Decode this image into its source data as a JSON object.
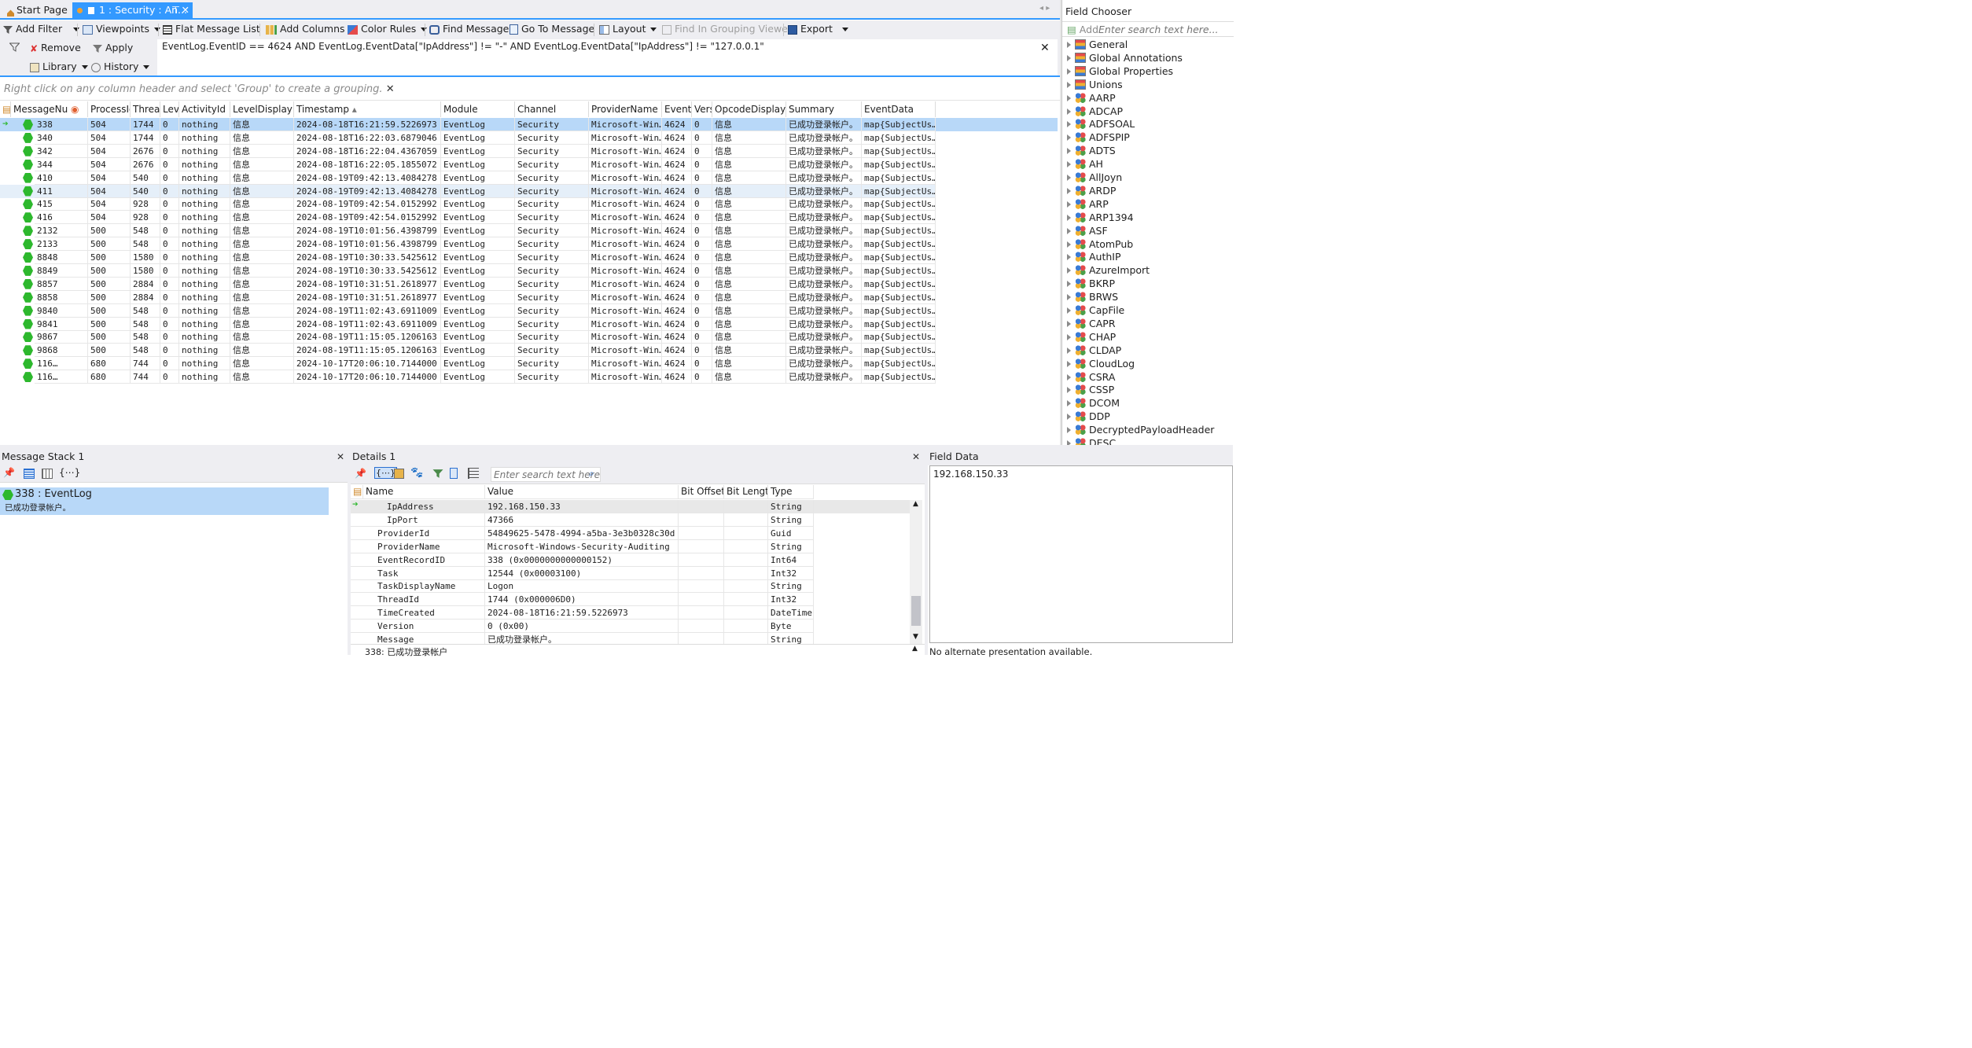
{
  "tabs": {
    "start_label": "Start Page",
    "active_label": "1 : Security : An..."
  },
  "toolbar": {
    "add_filter": "Add Filter",
    "viewpoints": "Viewpoints",
    "flat_list": "Flat Message List",
    "add_columns": "Add Columns",
    "color_rules": "Color Rules",
    "find_message": "Find Message",
    "go_to_message": "Go To Message",
    "layout": "Layout",
    "find_grouping": "Find In Grouping Viewer",
    "export": "Export"
  },
  "filter": {
    "remove": "Remove",
    "apply": "Apply",
    "library": "Library",
    "history": "History",
    "expression": "EventLog.EventID == 4624 AND EventLog.EventData[\"IpAddress\"] != \"-\" AND EventLog.EventData[\"IpAddress\"] != \"127.0.0.1\""
  },
  "grouping_hint": "Right click on any column header and select 'Group' to create a grouping.",
  "grid": {
    "columns": [
      "MessageNu",
      "ProcessId",
      "Threac",
      "Leve",
      "ActivityId",
      "LevelDisplayNa",
      "Timestamp",
      "Module",
      "Channel",
      "ProviderName",
      "EventI",
      "Vers",
      "OpcodeDisplayNa",
      "Summary",
      "EventData"
    ],
    "rows": [
      [
        "338",
        "504",
        "1744",
        "0",
        "nothing",
        "信息",
        "2024-08-18T16:21:59.5226973",
        "EventLog",
        "Security",
        "Microsoft-Win…",
        "4624",
        "0",
        "信息",
        "已成功登录帐户。",
        "map{SubjectUs…"
      ],
      [
        "340",
        "504",
        "1744",
        "0",
        "nothing",
        "信息",
        "2024-08-18T16:22:03.6879046",
        "EventLog",
        "Security",
        "Microsoft-Win…",
        "4624",
        "0",
        "信息",
        "已成功登录帐户。",
        "map{SubjectUs…"
      ],
      [
        "342",
        "504",
        "2676",
        "0",
        "nothing",
        "信息",
        "2024-08-18T16:22:04.4367059",
        "EventLog",
        "Security",
        "Microsoft-Win…",
        "4624",
        "0",
        "信息",
        "已成功登录帐户。",
        "map{SubjectUs…"
      ],
      [
        "344",
        "504",
        "2676",
        "0",
        "nothing",
        "信息",
        "2024-08-18T16:22:05.1855072",
        "EventLog",
        "Security",
        "Microsoft-Win…",
        "4624",
        "0",
        "信息",
        "已成功登录帐户。",
        "map{SubjectUs…"
      ],
      [
        "410",
        "504",
        "540",
        "0",
        "nothing",
        "信息",
        "2024-08-19T09:42:13.4084278",
        "EventLog",
        "Security",
        "Microsoft-Win…",
        "4624",
        "0",
        "信息",
        "已成功登录帐户。",
        "map{SubjectUs…"
      ],
      [
        "411",
        "504",
        "540",
        "0",
        "nothing",
        "信息",
        "2024-08-19T09:42:13.4084278",
        "EventLog",
        "Security",
        "Microsoft-Win…",
        "4624",
        "0",
        "信息",
        "已成功登录帐户。",
        "map{SubjectUs…"
      ],
      [
        "415",
        "504",
        "928",
        "0",
        "nothing",
        "信息",
        "2024-08-19T09:42:54.0152992",
        "EventLog",
        "Security",
        "Microsoft-Win…",
        "4624",
        "0",
        "信息",
        "已成功登录帐户。",
        "map{SubjectUs…"
      ],
      [
        "416",
        "504",
        "928",
        "0",
        "nothing",
        "信息",
        "2024-08-19T09:42:54.0152992",
        "EventLog",
        "Security",
        "Microsoft-Win…",
        "4624",
        "0",
        "信息",
        "已成功登录帐户。",
        "map{SubjectUs…"
      ],
      [
        "2132",
        "500",
        "548",
        "0",
        "nothing",
        "信息",
        "2024-08-19T10:01:56.4398799",
        "EventLog",
        "Security",
        "Microsoft-Win…",
        "4624",
        "0",
        "信息",
        "已成功登录帐户。",
        "map{SubjectUs…"
      ],
      [
        "2133",
        "500",
        "548",
        "0",
        "nothing",
        "信息",
        "2024-08-19T10:01:56.4398799",
        "EventLog",
        "Security",
        "Microsoft-Win…",
        "4624",
        "0",
        "信息",
        "已成功登录帐户。",
        "map{SubjectUs…"
      ],
      [
        "8848",
        "500",
        "1580",
        "0",
        "nothing",
        "信息",
        "2024-08-19T10:30:33.5425612",
        "EventLog",
        "Security",
        "Microsoft-Win…",
        "4624",
        "0",
        "信息",
        "已成功登录帐户。",
        "map{SubjectUs…"
      ],
      [
        "8849",
        "500",
        "1580",
        "0",
        "nothing",
        "信息",
        "2024-08-19T10:30:33.5425612",
        "EventLog",
        "Security",
        "Microsoft-Win…",
        "4624",
        "0",
        "信息",
        "已成功登录帐户。",
        "map{SubjectUs…"
      ],
      [
        "8857",
        "500",
        "2884",
        "0",
        "nothing",
        "信息",
        "2024-08-19T10:31:51.2618977",
        "EventLog",
        "Security",
        "Microsoft-Win…",
        "4624",
        "0",
        "信息",
        "已成功登录帐户。",
        "map{SubjectUs…"
      ],
      [
        "8858",
        "500",
        "2884",
        "0",
        "nothing",
        "信息",
        "2024-08-19T10:31:51.2618977",
        "EventLog",
        "Security",
        "Microsoft-Win…",
        "4624",
        "0",
        "信息",
        "已成功登录帐户。",
        "map{SubjectUs…"
      ],
      [
        "9840",
        "500",
        "548",
        "0",
        "nothing",
        "信息",
        "2024-08-19T11:02:43.6911009",
        "EventLog",
        "Security",
        "Microsoft-Win…",
        "4624",
        "0",
        "信息",
        "已成功登录帐户。",
        "map{SubjectUs…"
      ],
      [
        "9841",
        "500",
        "548",
        "0",
        "nothing",
        "信息",
        "2024-08-19T11:02:43.6911009",
        "EventLog",
        "Security",
        "Microsoft-Win…",
        "4624",
        "0",
        "信息",
        "已成功登录帐户。",
        "map{SubjectUs…"
      ],
      [
        "9867",
        "500",
        "548",
        "0",
        "nothing",
        "信息",
        "2024-08-19T11:15:05.1206163",
        "EventLog",
        "Security",
        "Microsoft-Win…",
        "4624",
        "0",
        "信息",
        "已成功登录帐户。",
        "map{SubjectUs…"
      ],
      [
        "9868",
        "500",
        "548",
        "0",
        "nothing",
        "信息",
        "2024-08-19T11:15:05.1206163",
        "EventLog",
        "Security",
        "Microsoft-Win…",
        "4624",
        "0",
        "信息",
        "已成功登录帐户。",
        "map{SubjectUs…"
      ],
      [
        "116…",
        "680",
        "744",
        "0",
        "nothing",
        "信息",
        "2024-10-17T20:06:10.7144000",
        "EventLog",
        "Security",
        "Microsoft-Win…",
        "4624",
        "0",
        "信息",
        "已成功登录帐户。",
        "map{SubjectUs…"
      ],
      [
        "116…",
        "680",
        "744",
        "0",
        "nothing",
        "信息",
        "2024-10-17T20:06:10.7144000",
        "EventLog",
        "Security",
        "Microsoft-Win…",
        "4624",
        "0",
        "信息",
        "已成功登录帐户。",
        "map{SubjectUs…"
      ]
    ]
  },
  "field_chooser": {
    "title": "Field Chooser",
    "add_label": "Add",
    "search_placeholder": "Enter search text here...",
    "items": [
      "General",
      "Global Annotations",
      "Global Properties",
      "Unions",
      "AARP",
      "ADCAP",
      "ADFSOAL",
      "ADFSPIP",
      "ADTS",
      "AH",
      "AllJoyn",
      "ARDP",
      "ARP",
      "ARP1394",
      "ASF",
      "AtomPub",
      "AuthIP",
      "AzureImport",
      "BKRP",
      "BRWS",
      "CapFile",
      "CAPR",
      "CHAP",
      "CLDAP",
      "CloudLog",
      "CSRA",
      "CSSP",
      "DCOM",
      "DDP",
      "DecryptedPayloadHeader",
      "DESC"
    ]
  },
  "message_stack": {
    "title": "Message Stack 1",
    "entry_title": "338 : EventLog",
    "entry_sub": "已成功登录帐户。"
  },
  "details": {
    "title": "Details 1",
    "search_placeholder": "Enter search text here",
    "columns": [
      "Name",
      "Value",
      "Bit Offset",
      "Bit Length",
      "Type"
    ],
    "rows": [
      [
        "IpAddress",
        "192.168.150.33",
        "",
        "",
        "String"
      ],
      [
        "IpPort",
        "47366",
        "",
        "",
        "String"
      ],
      [
        "ProviderId",
        "54849625-5478-4994-a5ba-3e3b0328c30d",
        "",
        "",
        "Guid"
      ],
      [
        "ProviderName",
        "Microsoft-Windows-Security-Auditing",
        "",
        "",
        "String"
      ],
      [
        "EventRecordID",
        "338 (0x0000000000000152)",
        "",
        "",
        "Int64"
      ],
      [
        "Task",
        "12544 (0x00003100)",
        "",
        "",
        "Int32"
      ],
      [
        "TaskDisplayName",
        "Logon",
        "",
        "",
        "String"
      ],
      [
        "ThreadId",
        "1744 (0x000006D0)",
        "",
        "",
        "Int32"
      ],
      [
        "TimeCreated",
        "2024-08-18T16:21:59.5226973",
        "",
        "",
        "DateTime"
      ],
      [
        "Version",
        "0 (0x00)",
        "",
        "",
        "Byte"
      ],
      [
        "Message",
        "已成功登录帐户。",
        "",
        "",
        "String"
      ]
    ],
    "footer": "338: 已成功登录帐户"
  },
  "field_data": {
    "title": "Field Data",
    "value": "192.168.150.33",
    "footer": "No alternate presentation available."
  },
  "colors": {
    "accent": "#3399ff",
    "selection": "#b8d8f8",
    "alt_row": "#e5eff9",
    "status_green": "#2db82d"
  }
}
